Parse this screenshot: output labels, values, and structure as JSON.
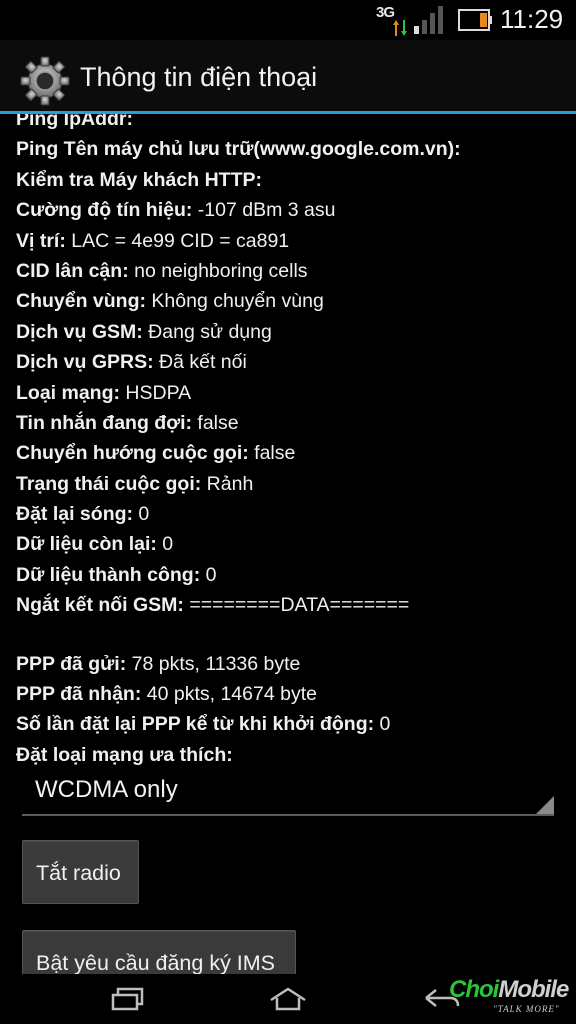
{
  "status_bar": {
    "network": "3G",
    "time": "11:29"
  },
  "header": {
    "title": "Thông tin điện thoại",
    "icon": "gear-icon"
  },
  "info_rows": [
    {
      "label": "Ping IpAddr:",
      "value": ""
    },
    {
      "label": "Ping Tên máy chủ lưu trữ(www.google.com.vn):",
      "value": ""
    },
    {
      "label": "Kiểm tra Máy khách HTTP:",
      "value": ""
    },
    {
      "label": "Cường độ tín hiệu:",
      "value": " -107 dBm   3 asu"
    },
    {
      "label": "Vị trí:",
      "value": " LAC = 4e99   CID = ca891"
    },
    {
      "label": "CID lân cận:",
      "value": " no neighboring cells"
    },
    {
      "label": "Chuyển vùng:",
      "value": " Không chuyển vùng"
    },
    {
      "label": "Dịch vụ GSM:",
      "value": " Đang sử dụng"
    },
    {
      "label": "Dịch vụ GPRS:",
      "value": " Đã kết nối"
    },
    {
      "label": "Loại mạng:",
      "value": " HSDPA"
    },
    {
      "label": "Tin nhắn đang đợi:",
      "value": " false"
    },
    {
      "label": "Chuyển hướng cuộc gọi:",
      "value": " false"
    },
    {
      "label": "Trạng thái cuộc gọi:",
      "value": " Rảnh"
    },
    {
      "label": "Đặt lại sóng:",
      "value": " 0"
    },
    {
      "label": "Dữ liệu còn lại:",
      "value": " 0"
    },
    {
      "label": "Dữ liệu thành công:",
      "value": " 0"
    },
    {
      "label": "Ngắt kết nối GSM:",
      "value": " ========DATA======="
    }
  ],
  "ppp_rows": [
    {
      "label": "PPP đã gửi:",
      "value": " 78 pkts, 11336 byte"
    },
    {
      "label": "PPP đã nhận:",
      "value": " 40 pkts, 14674 byte"
    },
    {
      "label": "Số lần đặt lại PPP kể từ khi khởi động:",
      "value": " 0"
    },
    {
      "label": "Đặt loại mạng ưa thích:",
      "value": ""
    }
  ],
  "preferred_network": {
    "selected": "WCDMA only"
  },
  "buttons": {
    "radio_off": "Tắt radio",
    "ims_register": "Bật yêu cầu đăng ký IMS"
  },
  "watermark": {
    "logo_green": "Choi",
    "logo_rest": "Mobile",
    "tagline": "\"TALK MORE\""
  },
  "colors": {
    "accent": "#2a9ed8",
    "battery_level": "#e8871e",
    "watermark_green": "#29c53c"
  }
}
